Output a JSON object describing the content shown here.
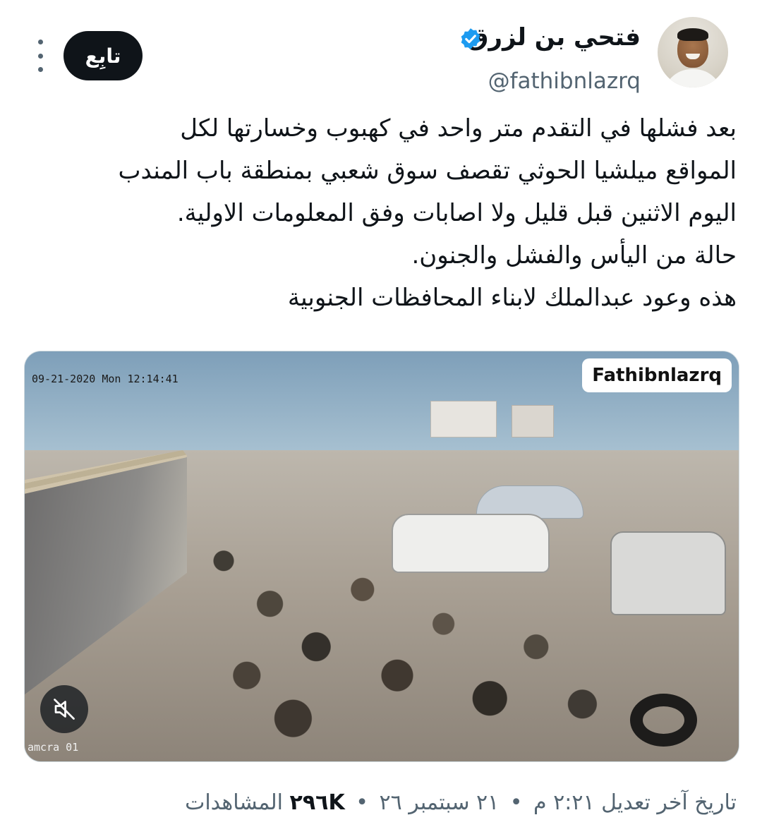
{
  "author": {
    "display_name": "فتحي بن لزرق",
    "handle": "@fathibnlazrq",
    "verified": true
  },
  "actions": {
    "follow_label": "تابِع"
  },
  "tweet": {
    "lines": [
      "بعد فشلها في التقدم متر واحد في كهبوب وخسارتها لكل",
      "المواقع ميلشيا الحوثي تقصف سوق شعبي بمنطقة باب المندب",
      "اليوم الاثنين قبل قليل ولا اصابات وفق المعلومات الاولية.",
      "حالة من اليأس والفشل والجنون.",
      "هذه وعود عبدالملك لابناء المحافظات الجنوبية"
    ]
  },
  "media": {
    "camera_timestamp": "09-21-2020 Mon 12:14:41",
    "camera_label": "amcra 01",
    "watermark": "Fathibnlazrq",
    "muted": true
  },
  "meta": {
    "edited_label": "تاريخ آخر تعديل",
    "time": "٢:٢١ م",
    "date": "٢١ سبتمبر ٢٦",
    "views_count": "٢٩٦K",
    "views_label": "المشاهدات",
    "separator": "•"
  },
  "colors": {
    "accent_verified": "#1d9bf0",
    "text_primary": "#0f1419",
    "text_secondary": "#536471",
    "follow_bg": "#0f1419"
  },
  "icons": {
    "verified": "verified-badge-icon",
    "more": "more-vertical-icon",
    "mute": "volume-muted-icon"
  }
}
